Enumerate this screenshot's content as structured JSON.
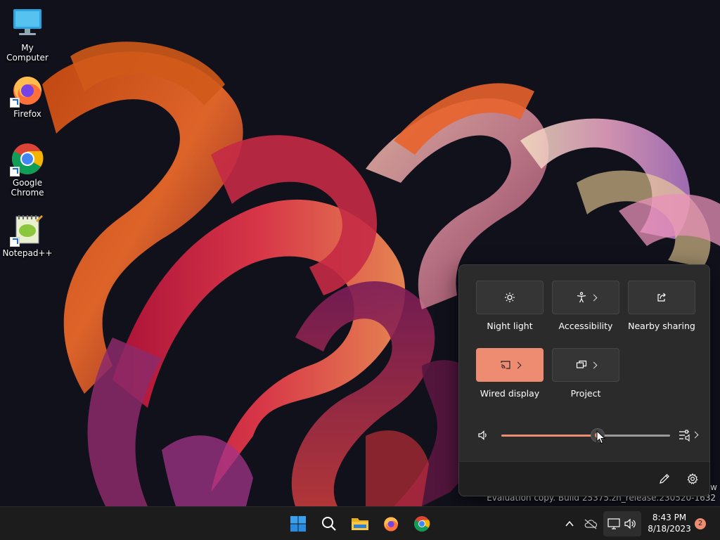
{
  "desktop": {
    "icons": [
      {
        "label": "My Computer"
      },
      {
        "label": "Firefox"
      },
      {
        "label": "Google Chrome"
      },
      {
        "label": "Notepad++"
      }
    ],
    "watermark_edge": "w",
    "watermark": "Evaluation copy. Build 25375.zn_release.230520-1632"
  },
  "quick_settings": {
    "tiles": [
      {
        "label": "Night light",
        "icon": "night-light-icon",
        "has_chevron": false,
        "on": false
      },
      {
        "label": "Accessibility",
        "icon": "accessibility-icon",
        "has_chevron": true,
        "on": false
      },
      {
        "label": "Nearby sharing",
        "icon": "share-icon",
        "has_chevron": false,
        "on": false
      },
      {
        "label": "Wired display",
        "icon": "cast-icon",
        "has_chevron": true,
        "on": true
      },
      {
        "label": "Project",
        "icon": "project-icon",
        "has_chevron": true,
        "on": false
      }
    ],
    "volume": {
      "level_percent": 57,
      "icon": "speaker-icon",
      "mixer_icon": "sound-mixer-icon"
    },
    "footer": {
      "edit_icon": "pencil-icon",
      "settings_icon": "gear-icon"
    }
  },
  "taskbar": {
    "apps": [
      "start-icon",
      "search-icon",
      "file-explorer-icon",
      "firefox-icon",
      "chrome-icon"
    ],
    "tray": {
      "time": "8:43 PM",
      "date": "8/18/2023",
      "notification_count": "2"
    }
  },
  "colors": {
    "accent": "#ee8c72",
    "panel": "#2b2b2b",
    "taskbar": "#1c1c1c"
  }
}
